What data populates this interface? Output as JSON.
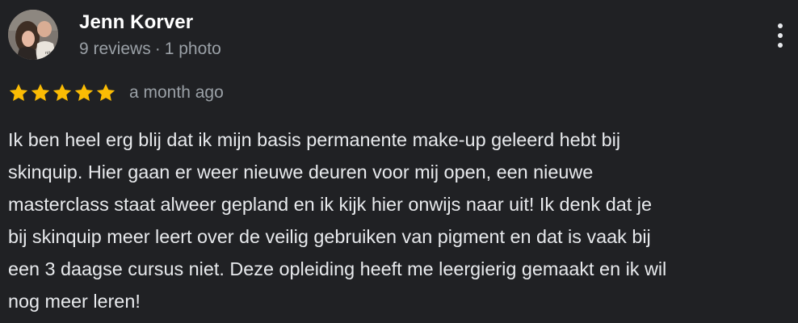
{
  "review": {
    "author": {
      "name": "Jenn Korver",
      "review_count": "9 reviews",
      "separator": "·",
      "photo_count": "1 photo",
      "avatar_icon": "profile-photo"
    },
    "rating": 5,
    "rating_max": 5,
    "star_color": "#fbbc04",
    "date": "a month ago",
    "more_icon": "more-vert-icon",
    "text_lines": [
      "Ik ben heel erg blij dat ik mijn basis permanente make-up geleerd hebt bij",
      "skinquip. Hier gaan er weer nieuwe deuren voor mij open, een nieuwe",
      "masterclass staat alweer gepland en ik kijk hier onwijs naar uit! Ik denk dat je",
      "bij skinquip meer leert over de veilig gebruiken van pigment en dat is vaak bij",
      "een 3 daagse cursus niet. Deze opleiding heeft me leergierig gemaakt en ik wil",
      "nog meer leren!"
    ]
  }
}
